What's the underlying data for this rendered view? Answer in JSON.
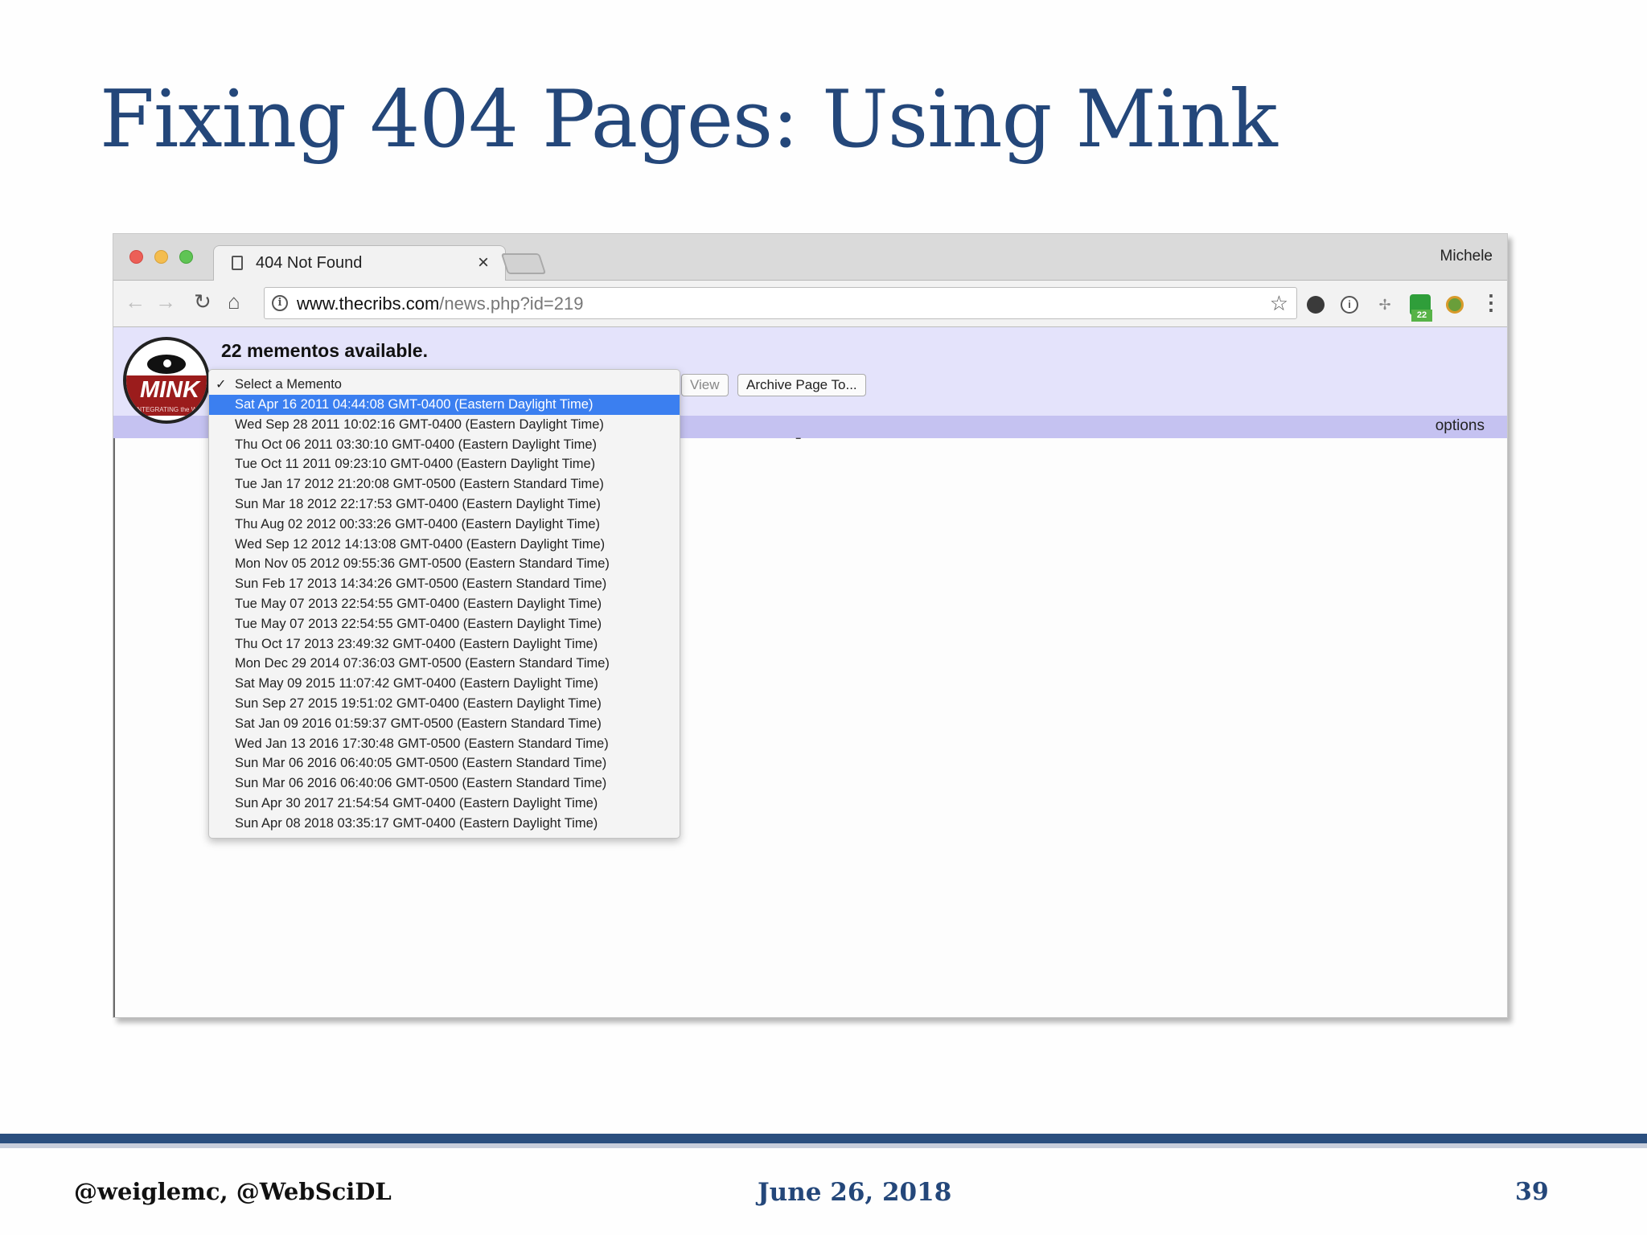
{
  "slide": {
    "title": "Fixing 404 Pages: Using Mink",
    "footer_left": "@weiglemc, @WebSciDL",
    "footer_center": "June 26, 2018",
    "footer_right": "39"
  },
  "browser": {
    "tab_title": "404 Not Found",
    "tab_close": "×",
    "profile_name": "Michele",
    "url_host": "www.thecribs.com",
    "url_path": "/news.php?id=219",
    "extension_badge": "22"
  },
  "mink": {
    "logo_text": "MINK",
    "logo_subtext": "INTEGRATING the WEB",
    "mementos_count_text": "22 mementos available.",
    "view_button": "View",
    "archive_button": "Archive Page To...",
    "options_link": "options",
    "dropdown": {
      "header": "Select a Memento",
      "items": [
        "Sat Apr 16 2011 04:44:08 GMT-0400 (Eastern Daylight Time)",
        "Wed Sep 28 2011 10:02:16 GMT-0400 (Eastern Daylight Time)",
        "Thu Oct 06 2011 03:30:10 GMT-0400 (Eastern Daylight Time)",
        "Tue Oct 11 2011 09:23:10 GMT-0400 (Eastern Daylight Time)",
        "Tue Jan 17 2012 21:20:08 GMT-0500 (Eastern Standard Time)",
        "Sun Mar 18 2012 22:17:53 GMT-0400 (Eastern Daylight Time)",
        "Thu Aug 02 2012 00:33:26 GMT-0400 (Eastern Daylight Time)",
        "Wed Sep 12 2012 14:13:08 GMT-0400 (Eastern Daylight Time)",
        "Mon Nov 05 2012 09:55:36 GMT-0500 (Eastern Standard Time)",
        "Sun Feb 17 2013 14:34:26 GMT-0500 (Eastern Standard Time)",
        "Tue May 07 2013 22:54:55 GMT-0400 (Eastern Daylight Time)",
        "Tue May 07 2013 22:54:55 GMT-0400 (Eastern Daylight Time)",
        "Thu Oct 17 2013 23:49:32 GMT-0400 (Eastern Daylight Time)",
        "Mon Dec 29 2014 07:36:03 GMT-0500 (Eastern Standard Time)",
        "Sat May 09 2015 11:07:42 GMT-0400 (Eastern Daylight Time)",
        "Sun Sep 27 2015 19:51:02 GMT-0400 (Eastern Daylight Time)",
        "Sat Jan 09 2016 01:59:37 GMT-0500 (Eastern Standard Time)",
        "Wed Jan 13 2016 17:30:48 GMT-0500 (Eastern Standard Time)",
        "Sun Mar 06 2016 06:40:05 GMT-0500 (Eastern Standard Time)",
        "Sun Mar 06 2016 06:40:06 GMT-0500 (Eastern Standard Time)",
        "Sun Apr 30 2017 21:54:54 GMT-0400 (Eastern Daylight Time)",
        "Sun Apr 08 2018 03:35:17 GMT-0400 (Eastern Daylight Time)"
      ]
    }
  },
  "colors": {
    "title_blue": "#24477a",
    "mink_bar": "#e4e3fb",
    "mink_stripe": "#c5c2f1",
    "selection_blue": "#3b7ff0"
  },
  "icons": [
    "page-icon",
    "back-arrow-icon",
    "forward-arrow-icon",
    "reload-icon",
    "home-icon",
    "info-icon",
    "star-icon",
    "menu-dots-icon",
    "check-icon"
  ]
}
